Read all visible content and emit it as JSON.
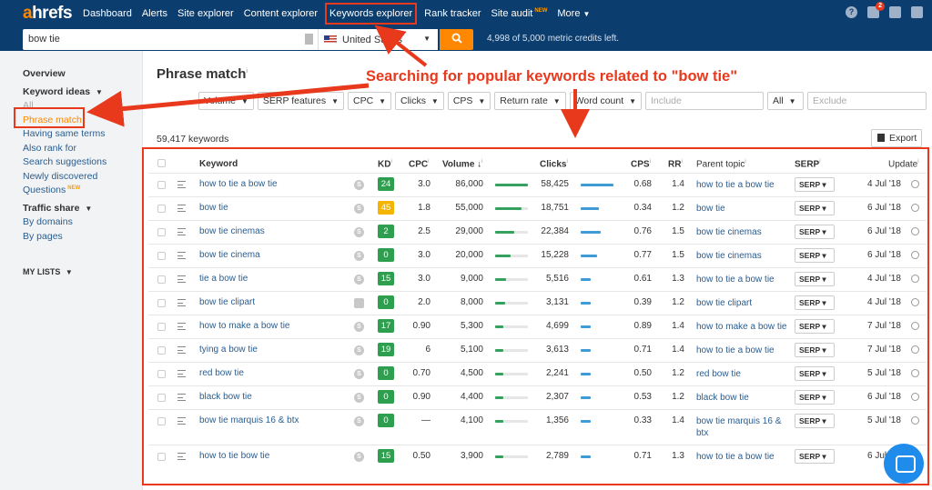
{
  "logo": {
    "a": "a",
    "rest": "hrefs"
  },
  "nav": {
    "dashboard": "Dashboard",
    "alerts": "Alerts",
    "site_explorer": "Site explorer",
    "content_explorer": "Content explorer",
    "keywords_explorer": "Keywords explorer",
    "rank_tracker": "Rank tracker",
    "site_audit": "Site audit",
    "site_audit_badge": "NEW",
    "more": "More"
  },
  "top_icons": {
    "help": "?",
    "notifications_count": "2"
  },
  "search": {
    "query": "bow tie",
    "country": "United States",
    "credits": "4,998 of 5,000 metric credits left."
  },
  "sidebar": {
    "overview": "Overview",
    "keyword_ideas": "Keyword ideas",
    "all": "All",
    "phrase_match": "Phrase match",
    "having_same_terms": "Having same terms",
    "also_rank_for": "Also rank for",
    "search_suggestions": "Search suggestions",
    "newly_discovered": "Newly discovered",
    "questions": "Questions",
    "questions_badge": "NEW",
    "traffic_share": "Traffic share",
    "by_domains": "By domains",
    "by_pages": "By pages",
    "my_lists": "MY LISTS"
  },
  "page_title": "Phrase match",
  "annotation": "Searching for popular keywords related to \"bow tie\"",
  "filters": {
    "volume": "Volume",
    "serp_features": "SERP features",
    "cpc": "CPC",
    "clicks": "Clicks",
    "cps": "CPS",
    "return_rate": "Return rate",
    "word_count": "Word count",
    "include_placeholder": "Include",
    "all": "All",
    "exclude_placeholder": "Exclude"
  },
  "keyword_count": "59,417 keywords",
  "export_label": "Export",
  "table": {
    "headers": {
      "keyword": "Keyword",
      "kd": "KD",
      "cpc": "CPC",
      "volume": "Volume",
      "clicks": "Clicks",
      "cps": "CPS",
      "rr": "RR",
      "parent_topic": "Parent topic",
      "serp": "SERP",
      "update": "Update"
    },
    "serp_button": "SERP",
    "rows": [
      {
        "keyword": "how to tie a bow tie",
        "kd": "24",
        "cpc": "3.0",
        "volume": "86,000",
        "clicks": "58,425",
        "cps": "0.68",
        "rr": "1.4",
        "parent": "how to tie a bow tie",
        "update": "4 Jul '18"
      },
      {
        "keyword": "bow tie",
        "kd": "45",
        "cpc": "1.8",
        "volume": "55,000",
        "clicks": "18,751",
        "cps": "0.34",
        "rr": "1.2",
        "parent": "bow tie",
        "update": "6 Jul '18"
      },
      {
        "keyword": "bow tie cinemas",
        "kd": "2",
        "cpc": "2.5",
        "volume": "29,000",
        "clicks": "22,384",
        "cps": "0.76",
        "rr": "1.5",
        "parent": "bow tie cinemas",
        "update": "6 Jul '18"
      },
      {
        "keyword": "bow tie cinema",
        "kd": "0",
        "cpc": "3.0",
        "volume": "20,000",
        "clicks": "15,228",
        "cps": "0.77",
        "rr": "1.5",
        "parent": "bow tie cinemas",
        "update": "6 Jul '18"
      },
      {
        "keyword": "tie a bow tie",
        "kd": "15",
        "cpc": "3.0",
        "volume": "9,000",
        "clicks": "5,516",
        "cps": "0.61",
        "rr": "1.3",
        "parent": "how to tie a bow tie",
        "update": "4 Jul '18"
      },
      {
        "keyword": "bow tie clipart",
        "kd": "0",
        "cpc": "2.0",
        "volume": "8,000",
        "clicks": "3,131",
        "cps": "0.39",
        "rr": "1.2",
        "parent": "bow tie clipart",
        "update": "4 Jul '18"
      },
      {
        "keyword": "how to make a bow tie",
        "kd": "17",
        "cpc": "0.90",
        "volume": "5,300",
        "clicks": "4,699",
        "cps": "0.89",
        "rr": "1.4",
        "parent": "how to make a bow tie",
        "update": "7 Jul '18"
      },
      {
        "keyword": "tying a bow tie",
        "kd": "19",
        "cpc": "6",
        "volume": "5,100",
        "clicks": "3,613",
        "cps": "0.71",
        "rr": "1.4",
        "parent": "how to tie a bow tie",
        "update": "7 Jul '18"
      },
      {
        "keyword": "red bow tie",
        "kd": "0",
        "cpc": "0.70",
        "volume": "4,500",
        "clicks": "2,241",
        "cps": "0.50",
        "rr": "1.2",
        "parent": "red bow tie",
        "update": "5 Jul '18"
      },
      {
        "keyword": "black bow tie",
        "kd": "0",
        "cpc": "0.90",
        "volume": "4,400",
        "clicks": "2,307",
        "cps": "0.53",
        "rr": "1.2",
        "parent": "black bow tie",
        "update": "6 Jul '18"
      },
      {
        "keyword": "bow tie marquis 16 & btx",
        "kd": "0",
        "cpc": "—",
        "volume": "4,100",
        "clicks": "1,356",
        "cps": "0.33",
        "rr": "1.4",
        "parent": "bow tie marquis 16 & btx",
        "update": "5 Jul '18"
      },
      {
        "keyword": "how to tie bow tie",
        "kd": "15",
        "cpc": "0.50",
        "volume": "3,900",
        "clicks": "2,789",
        "cps": "0.71",
        "rr": "1.3",
        "parent": "how to tie a bow tie",
        "update": "6 Jul '18"
      }
    ]
  },
  "colors": {
    "nav_bg": "#0b3d6e",
    "accent": "#ff8800",
    "annotation": "#e8391d",
    "kd_green": "#2e9f4e",
    "kd_yellow": "#f4b400",
    "link": "#2a5d8f"
  }
}
